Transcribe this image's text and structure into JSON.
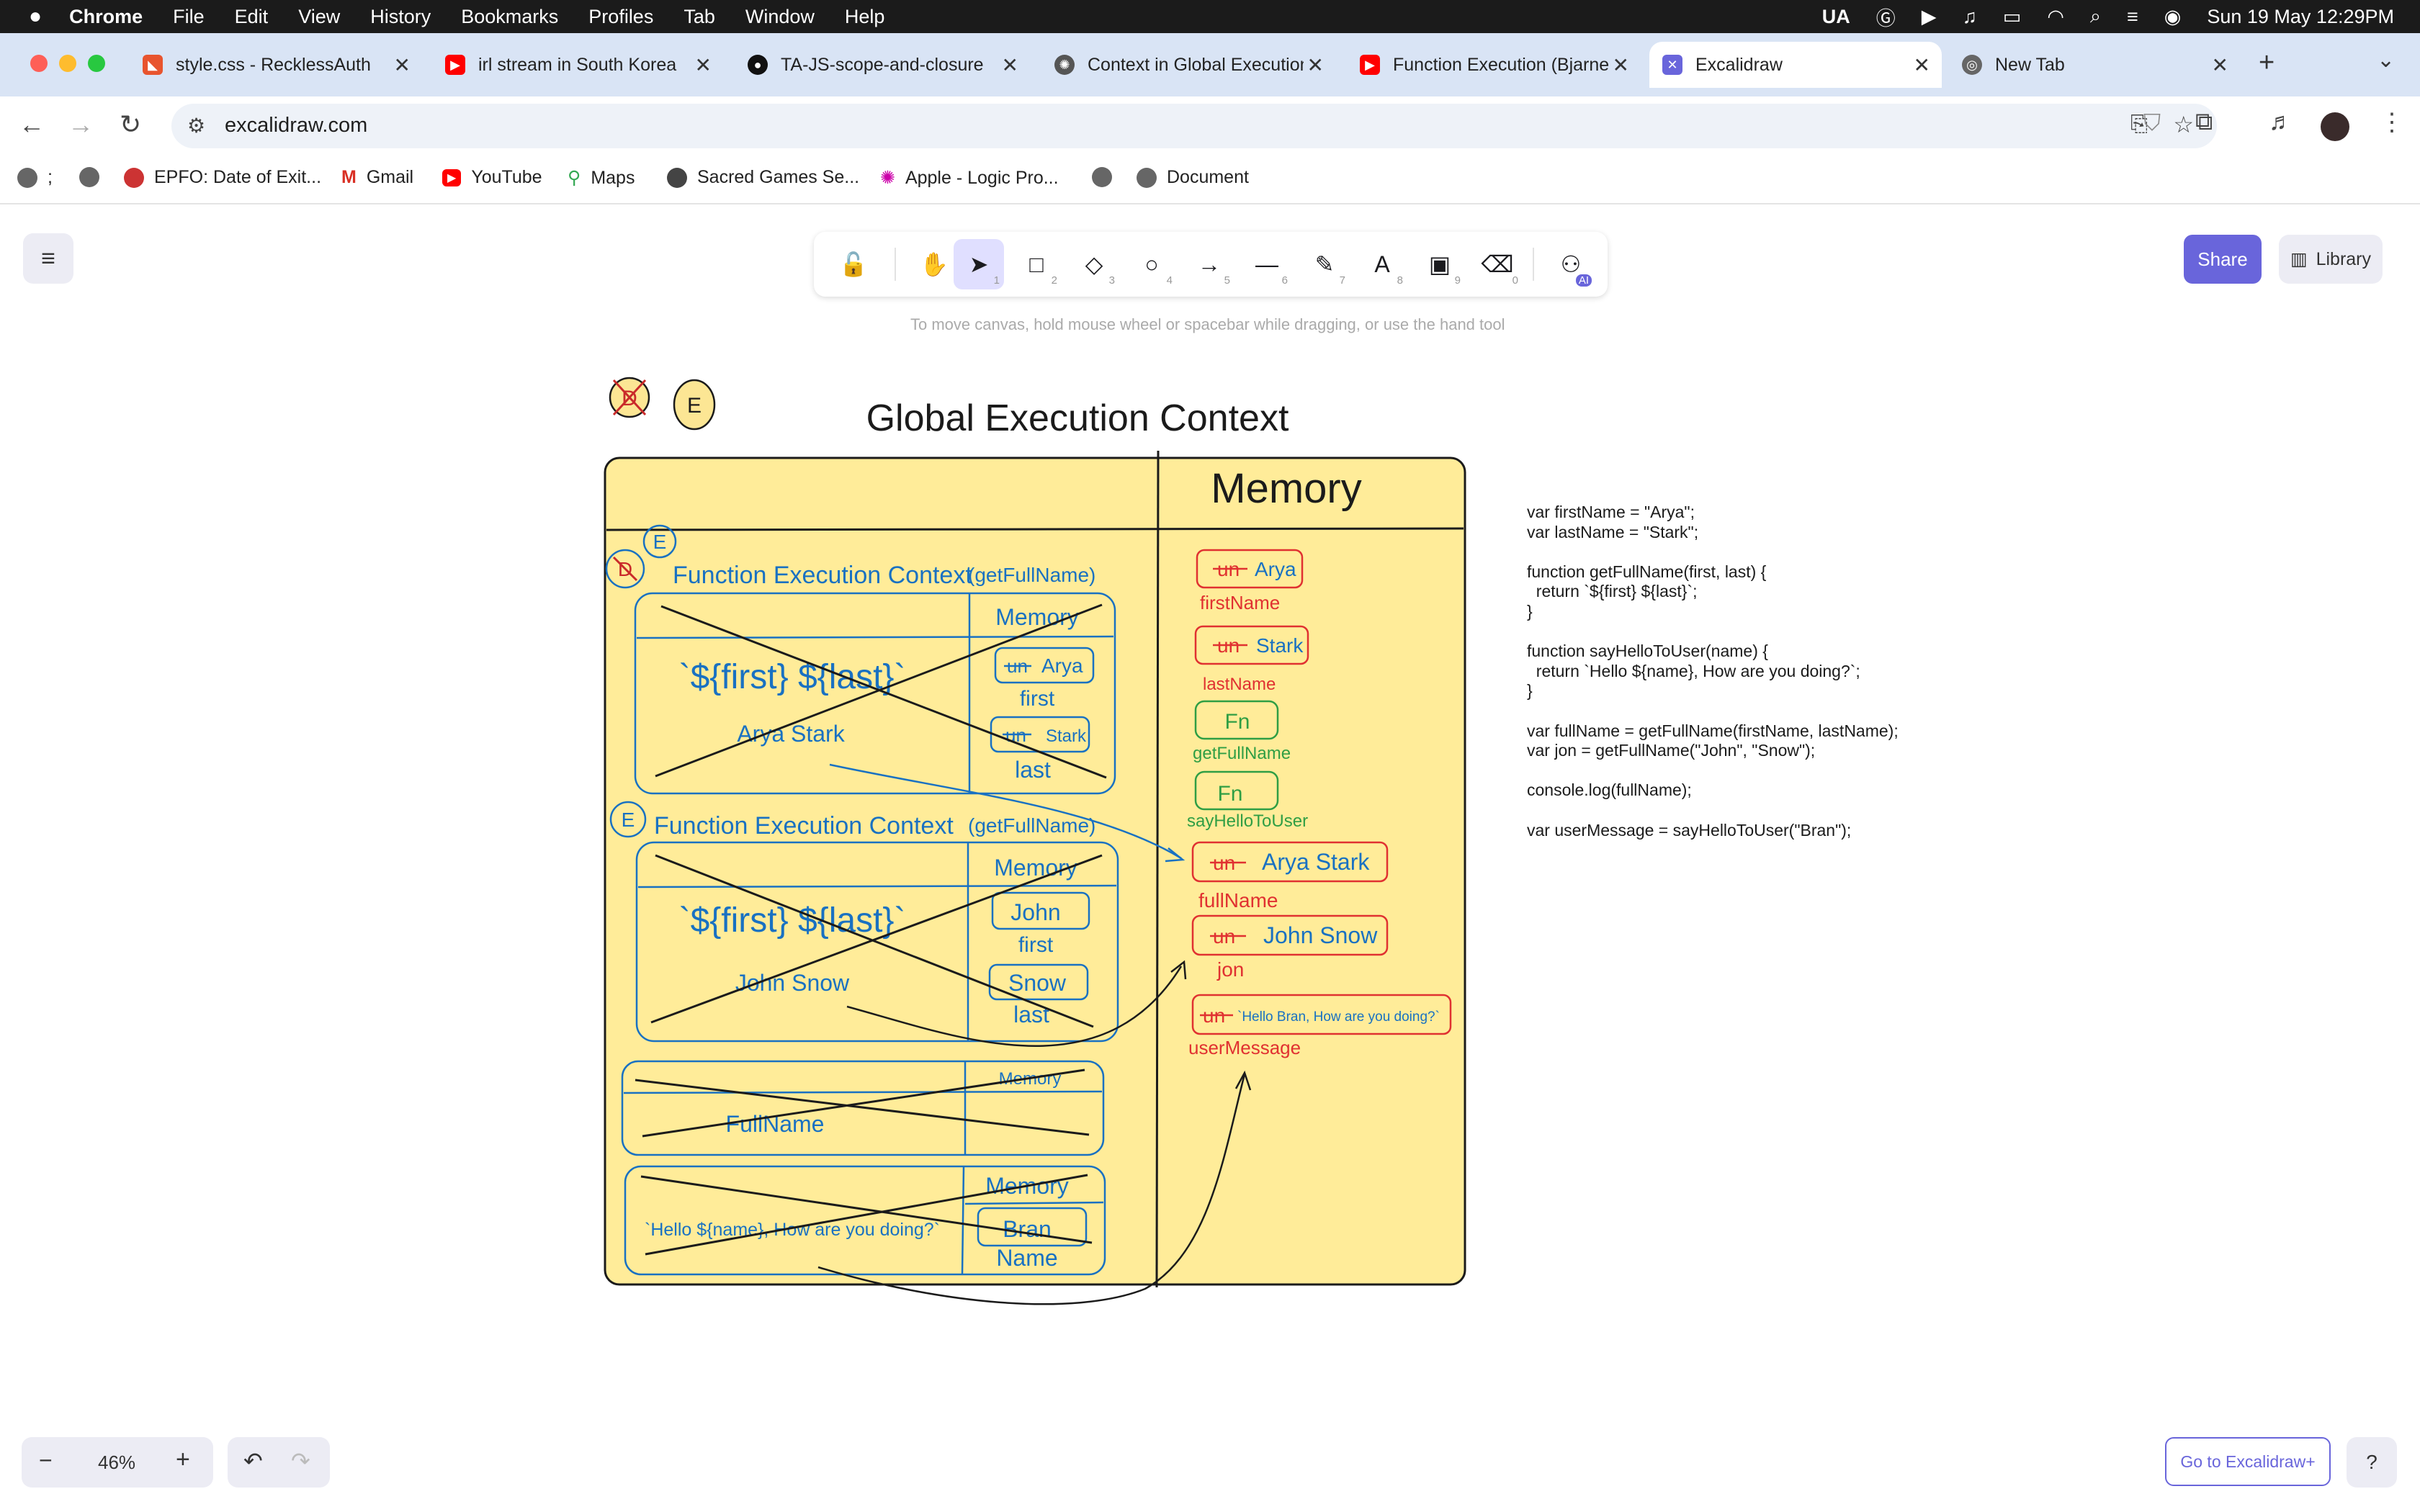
{
  "menubar": {
    "app": "Chrome",
    "items": [
      "File",
      "Edit",
      "View",
      "History",
      "Bookmarks",
      "Profiles",
      "Tab",
      "Window",
      "Help"
    ],
    "status": {
      "input": "UA",
      "clock": "Sun 19 May  12:29PM"
    }
  },
  "tabs": [
    {
      "title": "style.css - RecklessAuth",
      "color": "#e8542e"
    },
    {
      "title": "irl stream in South Korea",
      "color": "#ff0000"
    },
    {
      "title": "TA-JS-scope-and-closure",
      "color": "#111111"
    },
    {
      "title": "Context in Global Execution",
      "color": "#444444"
    },
    {
      "title": "Function Execution (Bjarne",
      "color": "#ff0000"
    },
    {
      "title": "Excalidraw",
      "color": "#6965db"
    },
    {
      "title": "New Tab",
      "color": "#666666"
    }
  ],
  "address": {
    "url": "excalidraw.com"
  },
  "bookmarks": [
    ";",
    "",
    "EPFO: Date of Exit...",
    "Gmail",
    "YouTube",
    "Maps",
    "Sacred Games Se...",
    "Apple - Logic Pro...",
    "",
    "Document"
  ],
  "excalidraw": {
    "share": "Share",
    "library": "Library",
    "hint": "To move canvas, hold mouse wheel or spacebar while dragging, or use the hand tool",
    "zoom": "46%",
    "plus": "Go to Excalidraw+",
    "tools": [
      {
        "name": "lock",
        "glyph": "🔓",
        "key": ""
      },
      {
        "name": "hand",
        "glyph": "✋",
        "key": ""
      },
      {
        "name": "selection",
        "glyph": "➤",
        "key": "1"
      },
      {
        "name": "rectangle",
        "glyph": "□",
        "key": "2"
      },
      {
        "name": "diamond",
        "glyph": "◇",
        "key": "3"
      },
      {
        "name": "ellipse",
        "glyph": "○",
        "key": "4"
      },
      {
        "name": "arrow",
        "glyph": "→",
        "key": "5"
      },
      {
        "name": "line",
        "glyph": "—",
        "key": "6"
      },
      {
        "name": "draw",
        "glyph": "✎",
        "key": "7"
      },
      {
        "name": "text",
        "glyph": "A",
        "key": "8"
      },
      {
        "name": "image",
        "glyph": "▣",
        "key": "9"
      },
      {
        "name": "eraser",
        "glyph": "⌫",
        "key": "0"
      },
      {
        "name": "ai",
        "glyph": "⚇",
        "key": "AI"
      }
    ]
  },
  "diagram": {
    "title": "Global Execution Context",
    "memory_title": "Memory",
    "badge_d": "D",
    "badge_e": "E",
    "fec1": {
      "title": "Function Execution Context",
      "sub": "(getFullName)",
      "memory": "Memory",
      "expr": "`${first} ${last}`",
      "result": "Arya Stark",
      "v1": "Arya",
      "n1": "first",
      "v2": "Stark",
      "n2": "last",
      "un": "un"
    },
    "fec2": {
      "title": "Function Execution Context",
      "sub": "(getFullName)",
      "memory": "Memory",
      "expr": "`${first} ${last}`",
      "result": "John Snow",
      "v1": "John",
      "n1": "first",
      "v2": "Snow",
      "n2": "last"
    },
    "fec3": {
      "memory": "Memory",
      "label": "FullName"
    },
    "fec4": {
      "memory": "Memory",
      "text": "`Hello ${name}, How are you doing?`",
      "v1": "Bran",
      "n1": "Name"
    },
    "gmem": [
      {
        "un": "un",
        "value": "Arya",
        "name": "firstName"
      },
      {
        "un": "un",
        "value": "Stark",
        "name": "lastName"
      },
      {
        "un": "",
        "value": "Fn",
        "name": "getFullName"
      },
      {
        "un": "",
        "value": "Fn",
        "name": "sayHelloToUser"
      },
      {
        "un": "un",
        "value": "Arya Stark",
        "name": "fullName"
      },
      {
        "un": "un",
        "value": "John Snow",
        "name": "jon"
      },
      {
        "un": "un",
        "value": "`Hello Bran, How are you doing?`",
        "name": "userMessage"
      }
    ],
    "code": [
      "var firstName = \"Arya\";",
      "var lastName = \"Stark\";",
      "",
      "function getFullName(first, last) {",
      "  return `${first} ${last}`;",
      "}",
      "",
      "function sayHelloToUser(name) {",
      "  return `Hello ${name}, How are you doing?`;",
      "}",
      "",
      "var fullName = getFullName(firstName, lastName);",
      "var jon = getFullName(\"John\", \"Snow\");",
      "",
      "console.log(fullName);",
      "",
      "var userMessage = sayHelloToUser(\"Bran\");"
    ]
  }
}
